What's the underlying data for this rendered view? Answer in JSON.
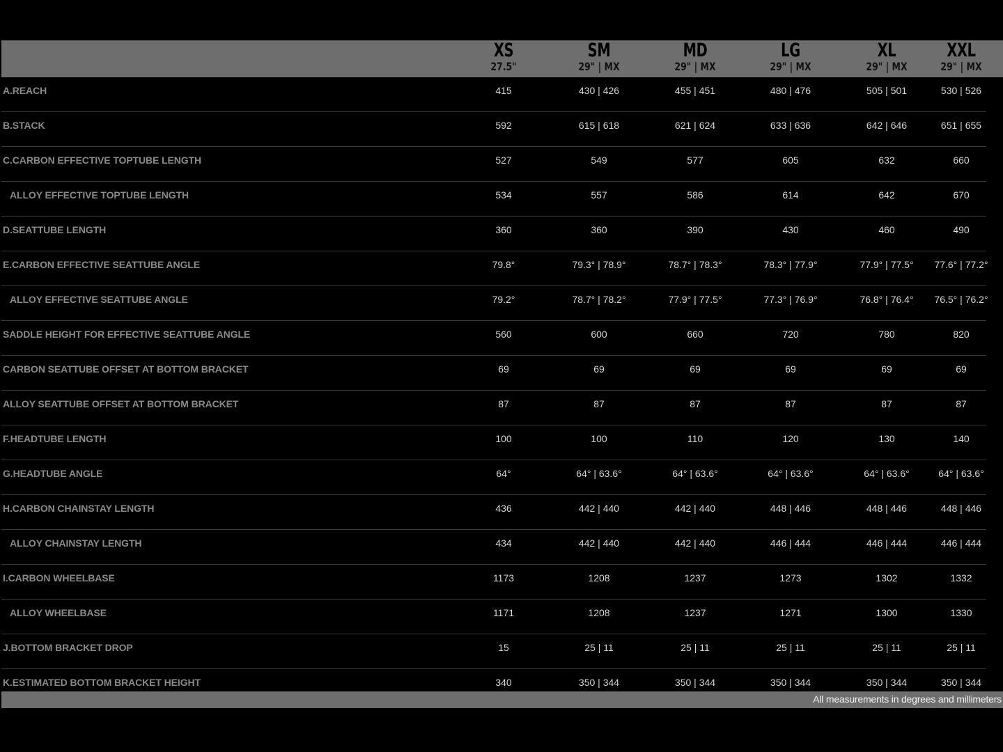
{
  "sizes": [
    {
      "name": "XS",
      "wheel": "27.5\""
    },
    {
      "name": "SM",
      "wheel": "29\" | MX"
    },
    {
      "name": "MD",
      "wheel": "29\" | MX"
    },
    {
      "name": "LG",
      "wheel": "29\" | MX"
    },
    {
      "name": "XL",
      "wheel": "29\" | MX"
    },
    {
      "name": "XXL",
      "wheel": "29\" | MX"
    }
  ],
  "rows": [
    {
      "label": "A.REACH",
      "sub": false,
      "values": [
        "415",
        "430 | 426",
        "455 | 451",
        "480 | 476",
        "505 | 501",
        "530 | 526"
      ]
    },
    {
      "label": "B.STACK",
      "sub": false,
      "values": [
        "592",
        "615 | 618",
        "621 | 624",
        "633 | 636",
        "642 | 646",
        "651 | 655"
      ]
    },
    {
      "label": "C.CARBON EFFECTIVE TOPTUBE LENGTH",
      "sub": false,
      "values": [
        "527",
        "549",
        "577",
        "605",
        "632",
        "660"
      ]
    },
    {
      "label": "ALLOY EFFECTIVE TOPTUBE LENGTH",
      "sub": true,
      "values": [
        "534",
        "557",
        "586",
        "614",
        "642",
        "670"
      ]
    },
    {
      "label": "D.SEATTUBE LENGTH",
      "sub": false,
      "values": [
        "360",
        "360",
        "390",
        "430",
        "460",
        "490"
      ]
    },
    {
      "label": "E.CARBON EFFECTIVE SEATTUBE ANGLE",
      "sub": false,
      "values": [
        "79.8°",
        "79.3° | 78.9°",
        "78.7° | 78.3°",
        "78.3° | 77.9°",
        "77.9° | 77.5°",
        "77.6° | 77.2°"
      ]
    },
    {
      "label": "ALLOY EFFECTIVE SEATTUBE ANGLE",
      "sub": true,
      "values": [
        "79.2°",
        "78.7° | 78.2°",
        "77.9° | 77.5°",
        "77.3° | 76.9°",
        "76.8° | 76.4°",
        "76.5° | 76.2°"
      ]
    },
    {
      "label": "SADDLE HEIGHT FOR EFFECTIVE SEATTUBE ANGLE",
      "sub": false,
      "values": [
        "560",
        "600",
        "660",
        "720",
        "780",
        "820"
      ]
    },
    {
      "label": "CARBON SEATTUBE OFFSET AT BOTTOM BRACKET",
      "sub": false,
      "values": [
        "69",
        "69",
        "69",
        "69",
        "69",
        "69"
      ]
    },
    {
      "label": "ALLOY SEATTUBE OFFSET AT BOTTOM BRACKET",
      "sub": false,
      "values": [
        "87",
        "87",
        "87",
        "87",
        "87",
        "87"
      ]
    },
    {
      "label": "F.HEADTUBE LENGTH",
      "sub": false,
      "values": [
        "100",
        "100",
        "110",
        "120",
        "130",
        "140"
      ]
    },
    {
      "label": "G.HEADTUBE ANGLE",
      "sub": false,
      "values": [
        "64°",
        "64° | 63.6°",
        "64° | 63.6°",
        "64° | 63.6°",
        "64° | 63.6°",
        "64° | 63.6°"
      ]
    },
    {
      "label": "H.CARBON CHAINSTAY LENGTH",
      "sub": false,
      "values": [
        "436",
        "442 | 440",
        "442 | 440",
        "448 | 446",
        "448 | 446",
        "448 | 446"
      ]
    },
    {
      "label": "ALLOY CHAINSTAY LENGTH",
      "sub": true,
      "values": [
        "434",
        "442 | 440",
        "442 | 440",
        "446 | 444",
        "446 | 444",
        "446 | 444"
      ]
    },
    {
      "label": "I.CARBON WHEELBASE",
      "sub": false,
      "values": [
        "1173",
        "1208",
        "1237",
        "1273",
        "1302",
        "1332"
      ]
    },
    {
      "label": "ALLOY WHEELBASE",
      "sub": true,
      "values": [
        "1171",
        "1208",
        "1237",
        "1271",
        "1300",
        "1330"
      ]
    },
    {
      "label": "J.BOTTOM BRACKET DROP",
      "sub": false,
      "values": [
        "15",
        "25 | 11",
        "25 | 11",
        "25 | 11",
        "25 | 11",
        "25 | 11"
      ]
    },
    {
      "label": "K.ESTIMATED BOTTOM BRACKET HEIGHT",
      "sub": false,
      "values": [
        "340",
        "350 | 344",
        "350 | 344",
        "350 | 344",
        "350 | 344",
        "350 | 344"
      ]
    }
  ],
  "footer": {
    "note": "All measurements in degrees and millimeters"
  },
  "colors": {
    "header_bg": "#6e6e6e",
    "page_bg": "#000000",
    "label": "#8a8a8a",
    "value": "#d6d6d6"
  }
}
